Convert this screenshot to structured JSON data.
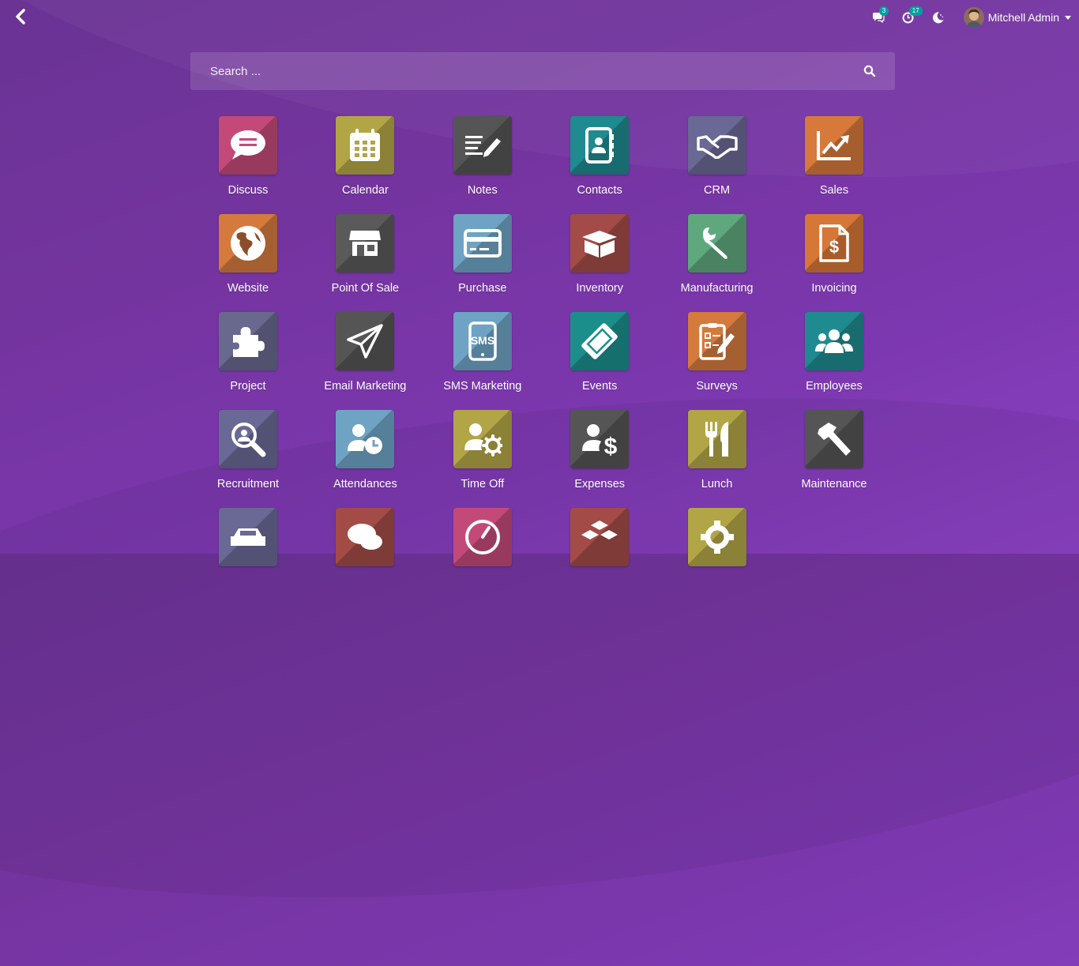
{
  "header": {
    "messages_badge": "3",
    "activities_badge": "17",
    "user_name": "Mitchell Admin"
  },
  "search": {
    "placeholder": "Search ..."
  },
  "apps": [
    {
      "label": "Discuss",
      "color": "#c34a78",
      "icon": "discuss-icon"
    },
    {
      "label": "Calendar",
      "color": "#b2a546",
      "icon": "calendar-icon"
    },
    {
      "label": "Notes",
      "color": "#555555",
      "icon": "notes-icon"
    },
    {
      "label": "Contacts",
      "color": "#1f8a8f",
      "icon": "contacts-icon"
    },
    {
      "label": "CRM",
      "color": "#6a6894",
      "icon": "crm-icon"
    },
    {
      "label": "Sales",
      "color": "#d6793b",
      "icon": "sales-icon"
    },
    {
      "label": "Website",
      "color": "#d47a3d",
      "icon": "website-icon"
    },
    {
      "label": "Point Of Sale",
      "color": "#5a5a5a",
      "icon": "point-of-sale-icon"
    },
    {
      "label": "Purchase",
      "color": "#6ea3c4",
      "icon": "purchase-icon"
    },
    {
      "label": "Inventory",
      "color": "#a34b47",
      "icon": "inventory-icon"
    },
    {
      "label": "Manufacturing",
      "color": "#5fa87e",
      "icon": "manufacturing-icon"
    },
    {
      "label": "Invoicing",
      "color": "#d67737",
      "icon": "invoicing-icon"
    },
    {
      "label": "Project",
      "color": "#69688f",
      "icon": "project-icon"
    },
    {
      "label": "Email Marketing",
      "color": "#555555",
      "icon": "email-marketing-icon"
    },
    {
      "label": "SMS Marketing",
      "color": "#6ea3c4",
      "icon": "sms-marketing-icon"
    },
    {
      "label": "Events",
      "color": "#1b8e8c",
      "icon": "events-icon"
    },
    {
      "label": "Surveys",
      "color": "#d47a3d",
      "icon": "surveys-icon"
    },
    {
      "label": "Employees",
      "color": "#1f8a8f",
      "icon": "employees-icon"
    },
    {
      "label": "Recruitment",
      "color": "#6a6894",
      "icon": "recruitment-icon"
    },
    {
      "label": "Attendances",
      "color": "#6ea3c4",
      "icon": "attendances-icon"
    },
    {
      "label": "Time Off",
      "color": "#b2a546",
      "icon": "time-off-icon"
    },
    {
      "label": "Expenses",
      "color": "#555555",
      "icon": "expenses-icon"
    },
    {
      "label": "Lunch",
      "color": "#b2a546",
      "icon": "lunch-icon"
    },
    {
      "label": "Maintenance",
      "color": "#555555",
      "icon": "maintenance-icon"
    },
    {
      "label": "",
      "color": "#6a6894",
      "icon": "fleet-icon"
    },
    {
      "label": "",
      "color": "#a34b47",
      "icon": "live-chat-icon"
    },
    {
      "label": "",
      "color": "#c34a78",
      "icon": "dashboards-icon"
    },
    {
      "label": "",
      "color": "#a34b47",
      "icon": "apps-icon"
    },
    {
      "label": "",
      "color": "#b2a546",
      "icon": "settings-icon"
    }
  ]
}
